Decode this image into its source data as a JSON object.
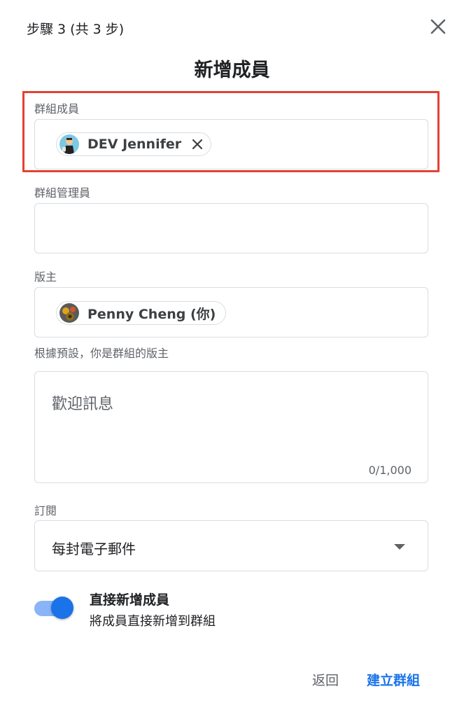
{
  "dialog": {
    "step_text": "步驟 3 (共 3 步)",
    "title": "新增成員"
  },
  "members": {
    "label": "群組成員",
    "chips": [
      {
        "name": "DEV Jennifer"
      }
    ]
  },
  "managers": {
    "label": "群組管理員"
  },
  "owner": {
    "label": "版主",
    "chip_name": "Penny Cheng (你)",
    "hint": "根據預設，你是群組的版主"
  },
  "welcome": {
    "placeholder": "歡迎訊息",
    "counter": "0/1,000"
  },
  "subscription": {
    "label": "訂閱",
    "value": "每封電子郵件"
  },
  "direct_add": {
    "title": "直接新增成員",
    "description": "將成員直接新增到群組",
    "enabled": true
  },
  "actions": {
    "back_label": "返回",
    "create_label": "建立群組"
  },
  "colors": {
    "accent": "#1a73e8",
    "highlight_border": "#e34234"
  }
}
